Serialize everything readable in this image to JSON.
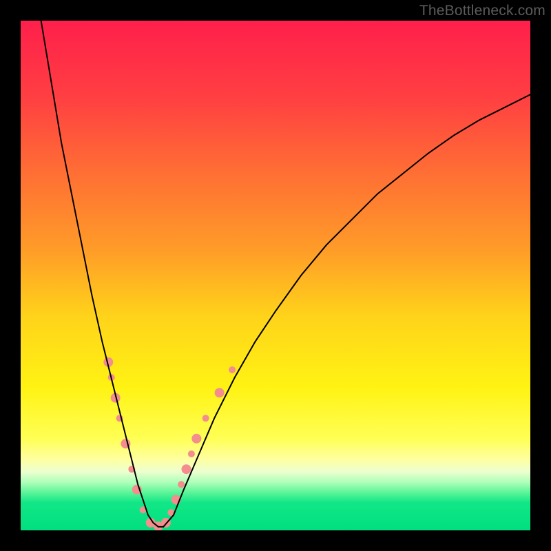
{
  "watermark": "TheBottleneck.com",
  "chart_data": {
    "type": "line",
    "title": "",
    "xlabel": "",
    "ylabel": "",
    "xlim": [
      0,
      100
    ],
    "ylim": [
      0,
      100
    ],
    "grid": false,
    "legend": false,
    "background": {
      "type": "vertical-gradient",
      "stops": [
        {
          "offset": 0.0,
          "color": "#ff1f4b"
        },
        {
          "offset": 0.15,
          "color": "#ff3f42"
        },
        {
          "offset": 0.3,
          "color": "#ff6f34"
        },
        {
          "offset": 0.45,
          "color": "#ff9c28"
        },
        {
          "offset": 0.58,
          "color": "#ffd31a"
        },
        {
          "offset": 0.72,
          "color": "#fff313"
        },
        {
          "offset": 0.82,
          "color": "#ffff55"
        },
        {
          "offset": 0.86,
          "color": "#ffffa0"
        },
        {
          "offset": 0.885,
          "color": "#ecffd0"
        },
        {
          "offset": 0.905,
          "color": "#b0ffba"
        },
        {
          "offset": 0.925,
          "color": "#60f59a"
        },
        {
          "offset": 0.945,
          "color": "#12e787"
        },
        {
          "offset": 1.0,
          "color": "#00df7f"
        }
      ]
    },
    "series": [
      {
        "name": "bottleneck-curve",
        "color": "#000000",
        "stroke_width": 2,
        "x": [
          4,
          6,
          8,
          10,
          12,
          14,
          16,
          17,
          18,
          19,
          20,
          21,
          22,
          23,
          24,
          25,
          26,
          27,
          28,
          30,
          32,
          35,
          38,
          42,
          46,
          50,
          55,
          60,
          65,
          70,
          75,
          80,
          85,
          90,
          95,
          100
        ],
        "y": [
          100,
          88,
          76,
          66,
          56,
          46,
          37,
          33,
          29,
          25,
          21,
          17,
          13,
          9,
          6,
          3,
          1.5,
          0.7,
          0.7,
          3,
          8,
          15,
          22,
          30,
          37,
          43,
          50,
          56,
          61,
          66,
          70,
          74,
          77.5,
          80.5,
          83,
          85.5
        ]
      }
    ],
    "markers": {
      "name": "highlight-dots",
      "color": "#f48d8d",
      "radius_small": 5,
      "radius_large": 7,
      "points": [
        {
          "x": 17.2,
          "y": 33,
          "r": "large"
        },
        {
          "x": 17.8,
          "y": 30,
          "r": "small"
        },
        {
          "x": 18.6,
          "y": 26,
          "r": "large"
        },
        {
          "x": 19.4,
          "y": 22,
          "r": "small"
        },
        {
          "x": 20.6,
          "y": 17,
          "r": "large"
        },
        {
          "x": 21.8,
          "y": 12,
          "r": "small"
        },
        {
          "x": 22.8,
          "y": 8,
          "r": "large"
        },
        {
          "x": 24.0,
          "y": 4,
          "r": "small"
        },
        {
          "x": 25.5,
          "y": 1.5,
          "r": "large"
        },
        {
          "x": 27.0,
          "y": 0.8,
          "r": "large"
        },
        {
          "x": 28.5,
          "y": 1.5,
          "r": "large"
        },
        {
          "x": 29.5,
          "y": 3.5,
          "r": "small"
        },
        {
          "x": 30.5,
          "y": 6,
          "r": "large"
        },
        {
          "x": 31.5,
          "y": 9,
          "r": "small"
        },
        {
          "x": 32.5,
          "y": 12,
          "r": "large"
        },
        {
          "x": 33.5,
          "y": 15,
          "r": "small"
        },
        {
          "x": 34.5,
          "y": 18,
          "r": "large"
        },
        {
          "x": 36.3,
          "y": 22,
          "r": "small"
        },
        {
          "x": 39.0,
          "y": 27,
          "r": "large"
        },
        {
          "x": 41.5,
          "y": 31.5,
          "r": "small"
        }
      ]
    }
  }
}
